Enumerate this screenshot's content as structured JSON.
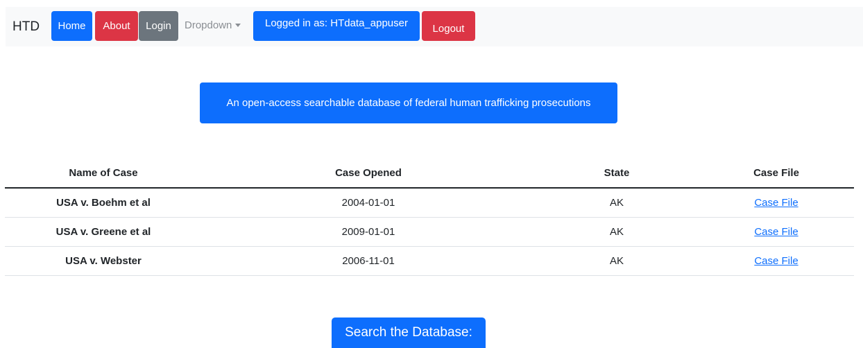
{
  "navbar": {
    "brand": "HTD",
    "home_label": "Home",
    "about_label": "About",
    "login_label": "Login",
    "dropdown_label": "Dropdown",
    "logged_in_text": "Logged in as: HTdata_appuser",
    "logout_label": "Logout"
  },
  "banner": {
    "text": "An open-access searchable database of federal human trafficking prosecutions"
  },
  "table": {
    "headers": [
      "Name of Case",
      "Case Opened",
      "State",
      "Case File"
    ],
    "rows": [
      {
        "name": "USA v. Boehm et al",
        "opened": "2004-01-01",
        "state": "AK",
        "file_link": "Case File"
      },
      {
        "name": "USA v. Greene et al",
        "opened": "2009-01-01",
        "state": "AK",
        "file_link": "Case File"
      },
      {
        "name": "USA v. Webster",
        "opened": "2006-11-01",
        "state": "AK",
        "file_link": "Case File"
      }
    ]
  },
  "search": {
    "button_label": "Search the Database:"
  },
  "colors": {
    "primary": "#0d6efd",
    "danger": "#dc3545",
    "secondary": "#6c757d",
    "navbar_bg": "#f8f9fa"
  }
}
